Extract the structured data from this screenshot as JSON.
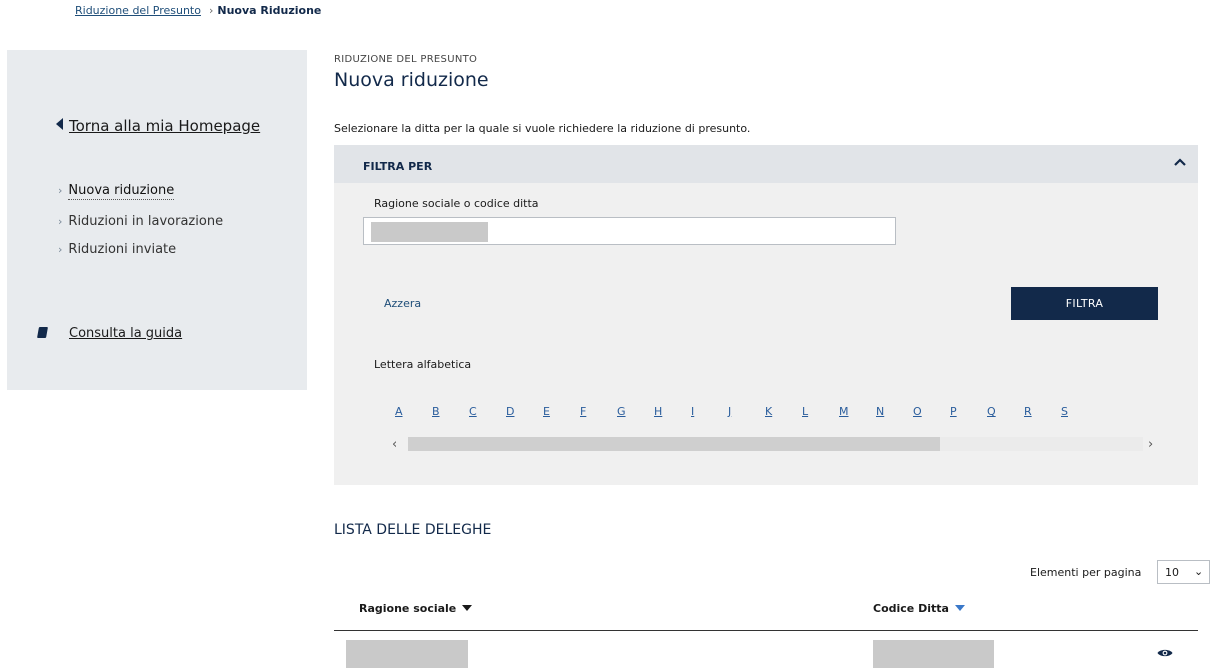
{
  "breadcrumb": {
    "parent": "Riduzione del Presunto",
    "separator": "›",
    "current": "Nuova Riduzione"
  },
  "sidebar": {
    "back_link": "Torna alla mia Homepage",
    "items": [
      {
        "label": "Nuova riduzione",
        "active": true
      },
      {
        "label": "Riduzioni in lavorazione",
        "active": false
      },
      {
        "label": "Riduzioni inviate",
        "active": false
      }
    ],
    "guide_link": "Consulta la guida"
  },
  "header": {
    "kicker": "RIDUZIONE DEL PRESUNTO",
    "title": "Nuova riduzione",
    "intro": "Selezionare la ditta per la quale si vuole richiedere la riduzione di presunto."
  },
  "filter": {
    "title": "FILTRA PER",
    "field_label": "Ragione sociale o codice ditta",
    "field_value": "",
    "reset_label": "Azzera",
    "button_label": "FILTRA",
    "letters_label": "Lettera alfabetica",
    "letters": [
      "A",
      "B",
      "C",
      "D",
      "E",
      "F",
      "G",
      "H",
      "I",
      "J",
      "K",
      "L",
      "M",
      "N",
      "O",
      "P",
      "Q",
      "R",
      "S"
    ],
    "scroll_left": "‹",
    "scroll_right": "›"
  },
  "list": {
    "title": "LISTA DELLE DELEGHE",
    "per_page_label": "Elementi per pagina",
    "per_page_value": "10",
    "per_page_caret": "⌄",
    "columns": [
      "Ragione sociale",
      "Codice Ditta"
    ]
  },
  "colors": {
    "primary": "#12294a",
    "link": "#2a5d9c",
    "panel": "#f0f0f0",
    "sidebar_bg": "#e8ebee"
  }
}
